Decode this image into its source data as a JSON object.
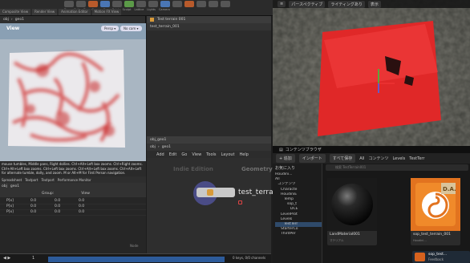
{
  "topbar": {
    "tabs": [
      "Composite View",
      "Render View",
      "Animation Editor",
      "Motion FX View"
    ],
    "tools": [
      "Drop",
      "Path",
      "Draw Curve",
      "Spray Paint",
      "Sculpt",
      "Lattice",
      "Lights",
      "Camera",
      "Spot Light",
      "Area Light",
      "Geometry Light",
      "Volume Light"
    ]
  },
  "leftpane": {
    "path": [
      "obj",
      "geo1"
    ],
    "view_label": "View",
    "persp": "Persp ▾",
    "cam": "No cam ▾",
    "status": "mouse tumbles, Middle pans, Right dollies. Ctrl+Alt+Left box zooms. Ctrl+Right zooms. Ctrl+Alt+Left box zooms. Ctrl+Left box zooms. Ctrl+Alt+Left box zooms. Ctrl+Alt+Left for alternate tumble, dolly, and zoom. M or Alt+M for First Person navigation."
  },
  "leftbottom": {
    "tabs": [
      "Spreadsheet",
      "Textport",
      "Textport",
      "Performance Monitor"
    ],
    "path": [
      "obj",
      "geo1"
    ],
    "group_label": "Group:",
    "view_label": "View",
    "rows": [
      [
        "P[x]",
        "0.0",
        "0.0",
        "0.0"
      ],
      [
        "P[x]",
        "0.0",
        "0.0",
        "0.0"
      ],
      [
        "P[x]",
        "0.0",
        "0.0",
        "0.0"
      ]
    ],
    "footer": "Node"
  },
  "middle": {
    "tab": "Test terrain 001",
    "path": "test_terrain_001",
    "node_tabs": [
      "obj_geo1"
    ],
    "node_path": [
      "obj",
      "geo1"
    ],
    "menu": [
      "Add",
      "Edit",
      "Go",
      "View",
      "Tools",
      "Layout",
      "Help"
    ],
    "watermark": "Indie Edition",
    "watermark2": "Geometry",
    "node_label": "test_terrain_..."
  },
  "timeline": {
    "frame": "1",
    "frame_end": "1",
    "info": "0 keys, 0/0 channels"
  },
  "ue": {
    "buttons": [
      "パースペクティブ",
      "ライティングあり",
      "表示"
    ]
  },
  "content_browser": {
    "title": "コンテンツブラウザ",
    "buttons": {
      "add": "+ 追加",
      "import": "インポート",
      "save_all": "すべて保存"
    },
    "breadcrumb": [
      "All",
      "コンテンツ",
      "Levels",
      "TestTerr"
    ],
    "favorites": "お気に入り",
    "search_placeholder": "検索 TestTerrain001",
    "tree": [
      "Houdini...",
      "All",
      "コンテンツ",
      "Characte",
      "HoudiniE",
      "Temp",
      "sop_t",
      "DCE",
      "LevelProt",
      "Levels",
      "TestTerr",
      "StarterCo",
      "ThirdPer"
    ],
    "tiles": [
      {
        "label": "LandMaterial001",
        "sub": "マテリアル"
      },
      {
        "label": "sop_test_terrain_001",
        "sub": "Houdini..."
      }
    ],
    "toast": {
      "line1": "sop_test...",
      "line2": "Feedback"
    }
  }
}
